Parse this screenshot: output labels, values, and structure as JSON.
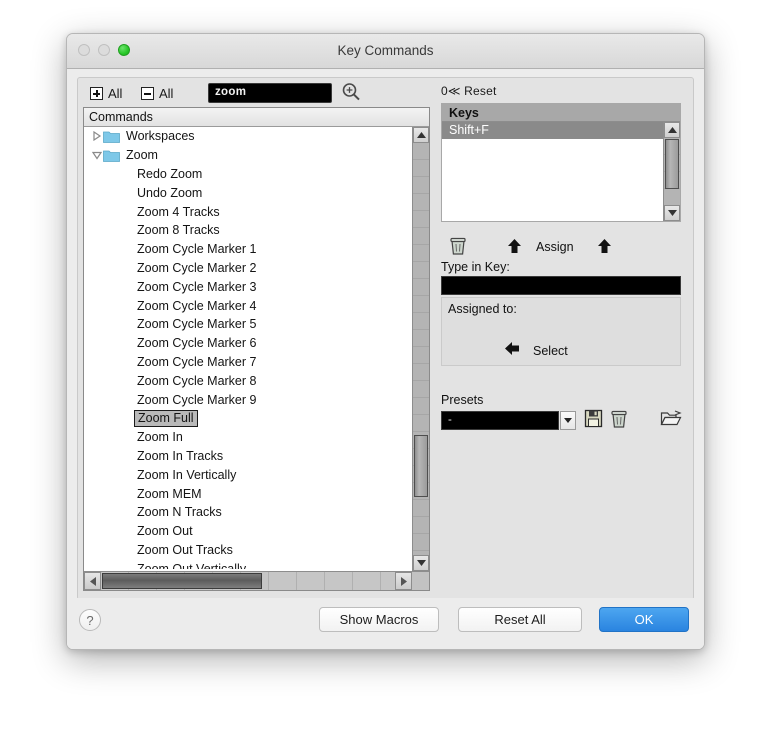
{
  "window": {
    "title": "Key Commands",
    "traffic": [
      "close-disabled",
      "minimize-disabled",
      "zoom-green"
    ]
  },
  "toolbar": {
    "expand_all_label": "All",
    "collapse_all_label": "All",
    "search_value": "zoom",
    "search_placeholder": "",
    "magnifier_icon": "magnifier-icon"
  },
  "commands": {
    "header": "Commands",
    "items": [
      {
        "label": "Workspaces",
        "type": "folder",
        "expanded": false,
        "selected": false
      },
      {
        "label": "Zoom",
        "type": "folder",
        "expanded": true,
        "selected": false
      },
      {
        "label": "Redo Zoom",
        "type": "leaf",
        "selected": false
      },
      {
        "label": "Undo Zoom",
        "type": "leaf",
        "selected": false
      },
      {
        "label": "Zoom 4 Tracks",
        "type": "leaf",
        "selected": false
      },
      {
        "label": "Zoom 8 Tracks",
        "type": "leaf",
        "selected": false
      },
      {
        "label": "Zoom Cycle Marker 1",
        "type": "leaf",
        "selected": false
      },
      {
        "label": "Zoom Cycle Marker 2",
        "type": "leaf",
        "selected": false
      },
      {
        "label": "Zoom Cycle Marker 3",
        "type": "leaf",
        "selected": false
      },
      {
        "label": "Zoom Cycle Marker 4",
        "type": "leaf",
        "selected": false
      },
      {
        "label": "Zoom Cycle Marker 5",
        "type": "leaf",
        "selected": false
      },
      {
        "label": "Zoom Cycle Marker 6",
        "type": "leaf",
        "selected": false
      },
      {
        "label": "Zoom Cycle Marker 7",
        "type": "leaf",
        "selected": false
      },
      {
        "label": "Zoom Cycle Marker 8",
        "type": "leaf",
        "selected": false
      },
      {
        "label": "Zoom Cycle Marker 9",
        "type": "leaf",
        "selected": false
      },
      {
        "label": "Zoom Full",
        "type": "leaf",
        "selected": true
      },
      {
        "label": "Zoom In",
        "type": "leaf",
        "selected": false
      },
      {
        "label": "Zoom In Tracks",
        "type": "leaf",
        "selected": false
      },
      {
        "label": "Zoom In Vertically",
        "type": "leaf",
        "selected": false
      },
      {
        "label": "Zoom MEM",
        "type": "leaf",
        "selected": false
      },
      {
        "label": "Zoom N Tracks",
        "type": "leaf",
        "selected": false
      },
      {
        "label": "Zoom Out",
        "type": "leaf",
        "selected": false
      },
      {
        "label": "Zoom Out Tracks",
        "type": "leaf",
        "selected": false
      },
      {
        "label": "Zoom Out Vertically",
        "type": "leaf",
        "selected": false,
        "clipped": true
      }
    ]
  },
  "keys_panel": {
    "reset_line": "0≪ Reset",
    "header": "Keys",
    "rows": [
      {
        "label": "Shift+F",
        "selected": true
      }
    ]
  },
  "assign": {
    "trash_icon": "trash-icon",
    "assign_label": "Assign",
    "up_arrow_icon": "up-arrow-icon",
    "type_in_key_label": "Type in Key:",
    "type_in_key_value": "",
    "assigned_to_label": "Assigned to:",
    "assigned_to_value": "",
    "select_label": "Select",
    "left_arrow_icon": "left-arrow-icon"
  },
  "presets": {
    "label": "Presets",
    "selected": "-",
    "dropdown_icon": "chevron-down-icon",
    "save_icon": "floppy-save-icon",
    "delete_icon": "trash-icon",
    "open_icon": "open-folder-icon"
  },
  "footer": {
    "help_label": "?",
    "show_macros_label": "Show Macros",
    "reset_all_label": "Reset All",
    "ok_label": "OK"
  },
  "colors": {
    "accent": "#2a84e0",
    "window_bg": "#ececec",
    "panel_bg": "#e3e3e3",
    "selection": "#b9b9b9",
    "key_selection": "#8a8a8a",
    "folder": "#7ec8e8"
  }
}
